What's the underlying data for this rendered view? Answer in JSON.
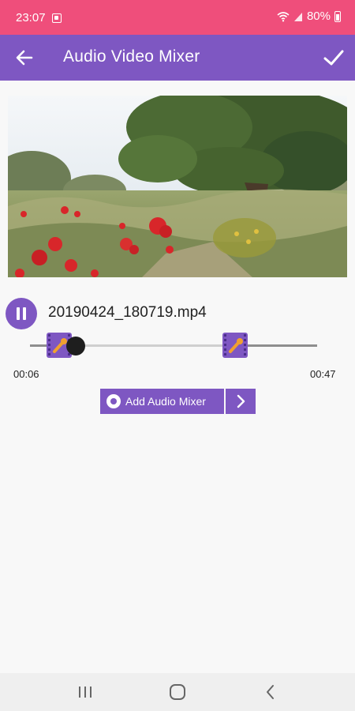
{
  "status_bar": {
    "time": "23:07",
    "battery": "80%",
    "icons": [
      "notification-icon",
      "wifi-icon",
      "signal-icon",
      "battery-icon"
    ]
  },
  "app_bar": {
    "title": "Audio Video Mixer",
    "back_icon": "arrow-left-icon",
    "confirm_icon": "checkmark-icon"
  },
  "preview": {
    "kind": "video-frame",
    "scene": "meadow with red poppies and a large tree"
  },
  "player": {
    "file_name": "20190424_180719.mp4",
    "state_icon": "pause-icon",
    "start_time": "00:06",
    "end_time": "00:47"
  },
  "actions": {
    "add_audio_label": "Add Audio Mixer",
    "add_audio_icon": "audio-disc-icon",
    "next_icon": "chevron-right-icon"
  },
  "nav_bar": {
    "items": [
      "recent-apps-icon",
      "home-icon",
      "back-icon"
    ]
  },
  "colors": {
    "status_bar": "#ef4e7b",
    "accent": "#7e57c2",
    "handle_marker": "#f0a030"
  }
}
